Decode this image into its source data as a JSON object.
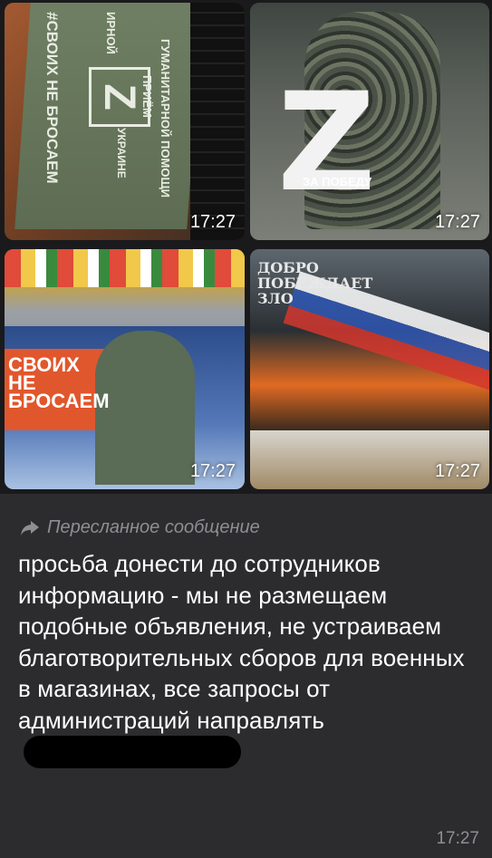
{
  "photos": [
    {
      "time": "17:27",
      "poster_lines": [
        "ПРИЁМ",
        "ГУМАНИТАРНОЙ ПОМОЩИ",
        "УКРАИНЕ",
        "#СВОИХ НЕ БРОСАЕМ",
        "ИРНОЙ"
      ],
      "letter": "Z"
    },
    {
      "time": "17:27",
      "letter": "Z",
      "caption": "ЗА ПОБЕДУ"
    },
    {
      "time": "17:27",
      "poster_lines": [
        "СВОИХ",
        "НЕ",
        "БРОСАЕМ"
      ]
    },
    {
      "time": "17:27",
      "poster_lines": [
        "ДОБРО",
        "ПОБЕЖДАЕТ",
        "ЗЛО"
      ]
    }
  ],
  "message": {
    "forwarded_label": "Пересланное сообщение",
    "text": "просьба донести до сотрудников информацию - мы не размещаем подобные объявления, не устраиваем благотворительных сборов для военных в магазинах, все запросы от администраций направлять",
    "time": "17:27"
  }
}
